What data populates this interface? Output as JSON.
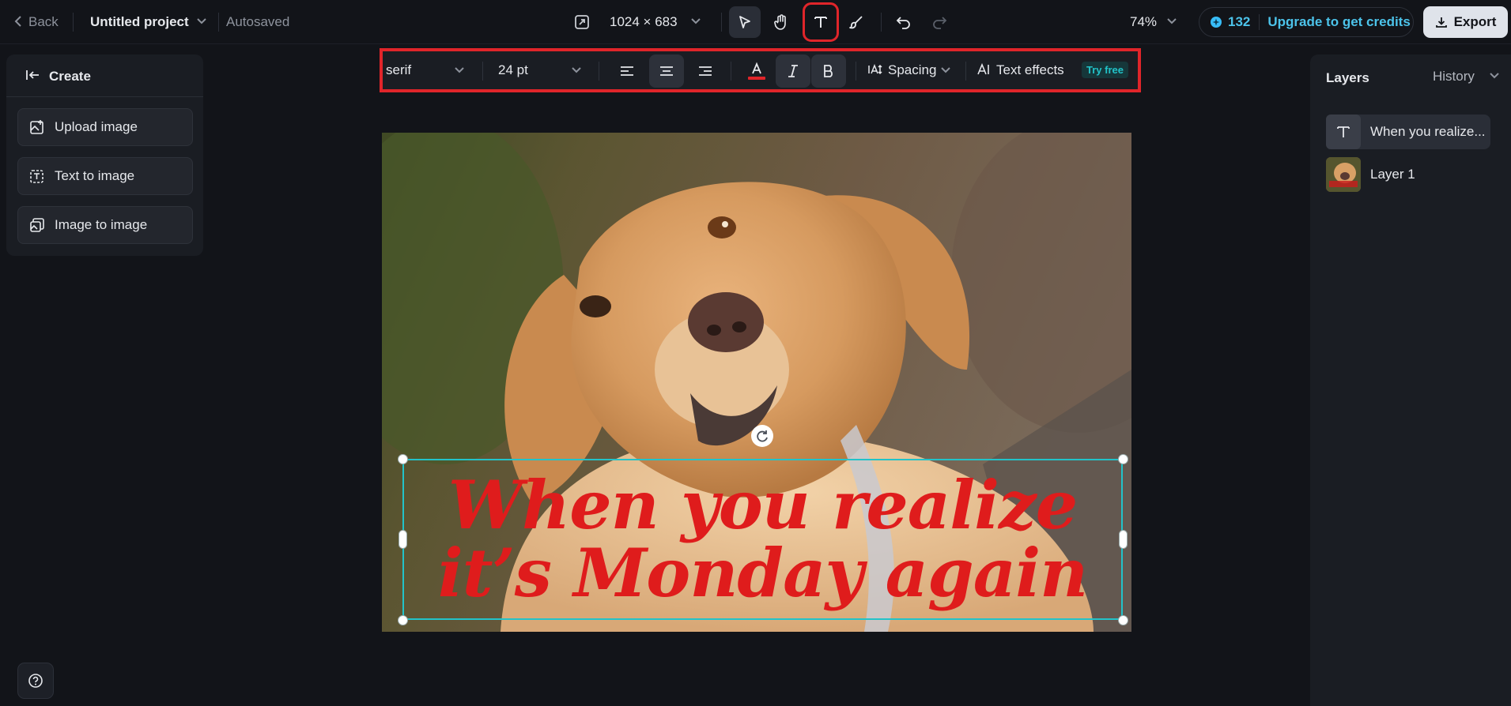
{
  "topbar": {
    "back_label": "Back",
    "project_title": "Untitled project",
    "save_status": "Autosaved",
    "canvas_size": "1024 × 683",
    "zoom": "74%",
    "credits_count": "132",
    "upgrade_label": "Upgrade to get credits",
    "export_label": "Export"
  },
  "text_toolbar": {
    "font_family": "serif",
    "font_size": "24 pt",
    "spacing_label": "Spacing",
    "effects_label": "Text effects",
    "try_free_badge": "Try free",
    "text_color": "#e0252a"
  },
  "left_panel": {
    "header": "Create",
    "buttons": [
      {
        "label": "Upload image"
      },
      {
        "label": "Text to image"
      },
      {
        "label": "Image to image"
      }
    ]
  },
  "right_panel": {
    "layers_title": "Layers",
    "history_label": "History",
    "layers": [
      {
        "name": "When you realize..."
      },
      {
        "name": "Layer 1"
      }
    ]
  },
  "canvas": {
    "text_line_1": "When you realize",
    "text_line_2": "it’s Monday again"
  },
  "colors": {
    "accent_teal": "#22c3c9",
    "highlight_red": "#e0252a",
    "text_red": "#df1c1c"
  }
}
